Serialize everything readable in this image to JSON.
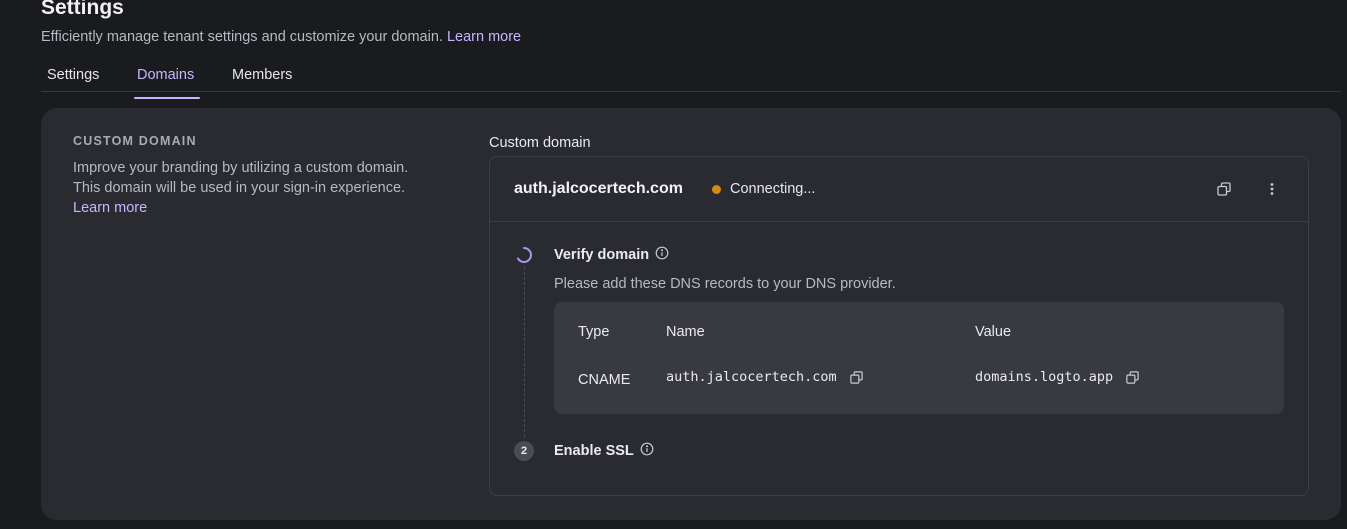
{
  "page": {
    "title": "Settings",
    "subtitle": "Efficiently manage tenant settings and customize your domain.",
    "subtitle_link": "Learn more"
  },
  "tabs": [
    {
      "label": "Settings",
      "active": false
    },
    {
      "label": "Domains",
      "active": true
    },
    {
      "label": "Members",
      "active": false
    }
  ],
  "section": {
    "heading": "CUSTOM DOMAIN",
    "description": "Improve your branding by utilizing a custom domain. This domain will be used in your sign-in experience.",
    "learn_more": "Learn more"
  },
  "custom_domain": {
    "label": "Custom domain",
    "domain": "auth.jalcocertech.com",
    "status": "Connecting...",
    "status_color": "#d9890f"
  },
  "steps": [
    {
      "title": "Verify domain",
      "state": "in-progress",
      "description": "Please add these DNS records to your DNS provider."
    },
    {
      "title": "Enable SSL",
      "number": "2",
      "state": "pending"
    }
  ],
  "dns_table": {
    "columns": [
      "Type",
      "Name",
      "Value"
    ],
    "rows": [
      {
        "type": "CNAME",
        "name": "auth.jalcocertech.com",
        "value": "domains.logto.app"
      }
    ]
  },
  "colors": {
    "accent": "#c7b6ff",
    "background": "#1a1b1e",
    "card": "#2a2b31",
    "table": "#383941"
  },
  "icons": {
    "copy": "copy-icon",
    "more": "more-vertical-icon",
    "info": "info-icon",
    "spinner": "spinner-icon"
  }
}
